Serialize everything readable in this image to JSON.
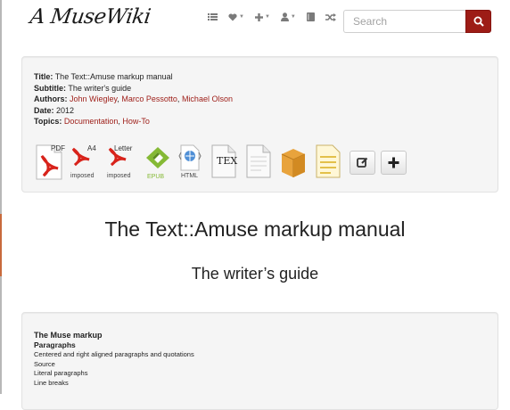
{
  "site": {
    "logo_text": "A MuseWiki"
  },
  "search": {
    "placeholder": "Search"
  },
  "nav_icons": [
    "list-icon",
    "heart-icon",
    "plus-icon",
    "user-icon",
    "book-icon",
    "shuffle-icon"
  ],
  "colors": {
    "brand": "#9d1c16",
    "well_bg": "#f5f5f5",
    "text": "#222222"
  },
  "meta": {
    "title_label": "Title:",
    "title_value": "The Text::Amuse markup manual",
    "subtitle_label": "Subtitle:",
    "subtitle_value": "The writer's guide",
    "authors_label": "Authors:",
    "authors": [
      "John Wiegley",
      "Marco Pessotto",
      "Michael Olson"
    ],
    "date_label": "Date:",
    "date_value": "2012",
    "topics_label": "Topics:",
    "topics": [
      "Documentation",
      "How-To"
    ]
  },
  "formats": {
    "pdf_tag": "PDF",
    "a4_tag": "A4",
    "a4_caption": "imposed",
    "letter_tag": "Letter",
    "letter_caption": "imposed",
    "epub_caption": "EPUB",
    "html_caption": "HTML",
    "tex_tag": "TEX"
  },
  "document": {
    "title": "The Text::Amuse markup manual",
    "subtitle": "The writer’s guide"
  },
  "toc": {
    "heading": "The Muse markup",
    "subheading": "Paragraphs",
    "items": [
      "Centered and right aligned paragraphs and quotations",
      "Source",
      "Literal paragraphs",
      "Line breaks"
    ]
  }
}
